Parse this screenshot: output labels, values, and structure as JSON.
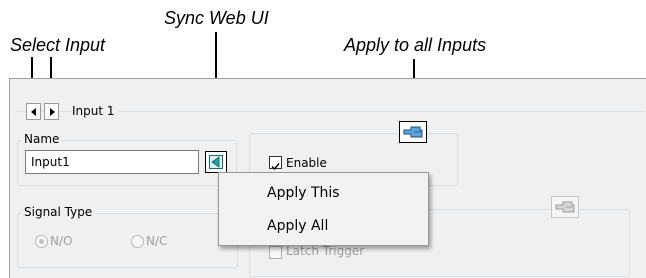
{
  "callouts": {
    "select_input": "Select Input",
    "sync_web_ui": "Sync Web UI",
    "apply_to_all": "Apply to all Inputs"
  },
  "header": {
    "input_title": "Input 1"
  },
  "name_group": {
    "label": "Name",
    "input_value": "Input1"
  },
  "enable_group": {
    "enable_label": "Enable",
    "enable_checked": true
  },
  "signal_type": {
    "label": "Signal Type",
    "options": [
      "N/O",
      "N/C"
    ],
    "selected": "N/O"
  },
  "trigger": {
    "latch_label": "Latch Trigger"
  },
  "context_menu": {
    "items": [
      "Apply This",
      "Apply All"
    ]
  },
  "colors": {
    "sync_icon": "#1fa5a5",
    "apply_icon": "#3a8ac4",
    "panel_bg": "#f0f0f0"
  },
  "icons": {
    "prev": "left-arrow-icon",
    "next": "right-arrow-icon",
    "sync": "sync-triangle-icon",
    "apply": "pointing-hand-icon"
  }
}
